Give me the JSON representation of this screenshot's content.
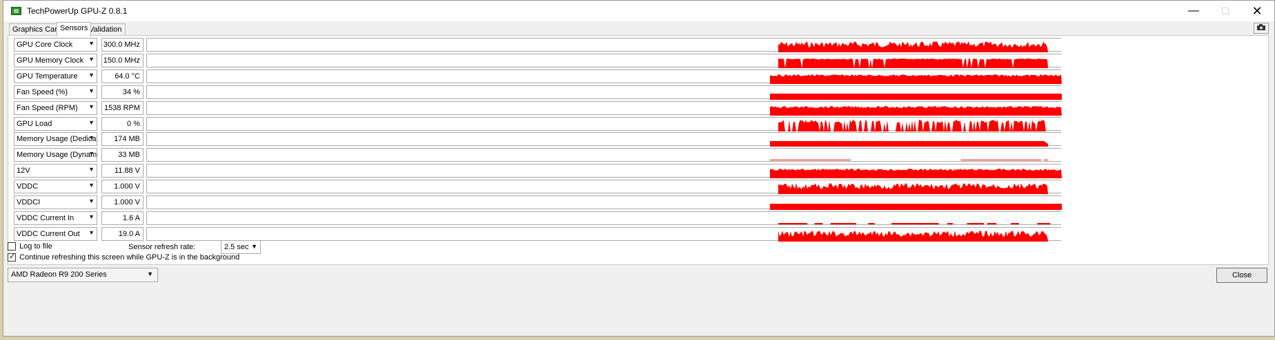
{
  "window": {
    "title": "TechPowerUp GPU-Z 0.8.1",
    "minimize": "—",
    "maximize": "☐",
    "close": "✕"
  },
  "tabs": [
    {
      "label": "Graphics Card",
      "active": false
    },
    {
      "label": "Sensors",
      "active": true
    },
    {
      "label": "Validation",
      "active": false
    }
  ],
  "camera_icon": "camera-icon",
  "graph_color": "#ff0000",
  "sensors": [
    {
      "name": "GPU Core Clock",
      "value": "300.0 MHz",
      "profile": "spiky"
    },
    {
      "name": "GPU Memory Clock",
      "value": "150.0 MHz",
      "profile": "block"
    },
    {
      "name": "GPU Temperature",
      "value": "64.0 °C",
      "profile": "smooth"
    },
    {
      "name": "Fan Speed (%)",
      "value": "34 %",
      "profile": "flat"
    },
    {
      "name": "Fan Speed (RPM)",
      "value": "1538 RPM",
      "profile": "smooth"
    },
    {
      "name": "GPU Load",
      "value": "0 %",
      "profile": "load"
    },
    {
      "name": "Memory Usage (Dedicated)",
      "value": "174 MB",
      "profile": "mem"
    },
    {
      "name": "Memory Usage (Dynamic)",
      "value": "33 MB",
      "profile": "thin"
    },
    {
      "name": "12V",
      "value": "11.88 V",
      "profile": "smooth"
    },
    {
      "name": "VDDC",
      "value": "1.000 V",
      "profile": "spiky"
    },
    {
      "name": "VDDCI",
      "value": "1.000 V",
      "profile": "flat"
    },
    {
      "name": "VDDC Current In",
      "value": "1.6 A",
      "profile": "dash"
    },
    {
      "name": "VDDC Current Out",
      "value": "19.0 A",
      "profile": "spiky"
    }
  ],
  "options": {
    "log_to_file": {
      "label": "Log to file",
      "checked": false
    },
    "continue_refresh": {
      "label": "Continue refreshing this screen while GPU-Z is in the background",
      "checked": true
    },
    "refresh_rate_label": "Sensor refresh rate:",
    "refresh_rate_value": "2.5 sec"
  },
  "gpu_select": "AMD Radeon R9 200 Series",
  "close_button": "Close"
}
